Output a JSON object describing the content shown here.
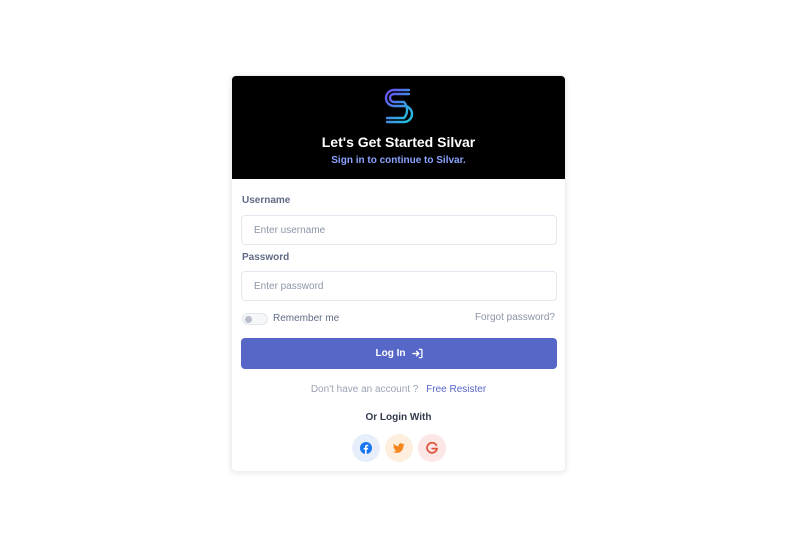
{
  "header": {
    "title": "Let's Get Started Silvar",
    "subtitle": "Sign in to continue to Silvar."
  },
  "form": {
    "username_label": "Username",
    "username_placeholder": "Enter username",
    "username_value": "",
    "password_label": "Password",
    "password_placeholder": "Enter password",
    "password_value": "",
    "remember_label": "Remember me",
    "remember_checked": false,
    "forgot_label": "Forgot password?",
    "login_label": "Log In"
  },
  "register": {
    "prompt": "Don't have an account ?",
    "link_label": "Free Resister"
  },
  "social": {
    "heading": "Or Login With",
    "buttons": [
      "facebook-icon",
      "twitter-icon",
      "google-icon"
    ]
  },
  "colors": {
    "header_bg": "#000000",
    "accent": "#5767c8",
    "facebook": "#1877f2",
    "twitter": "#f5861f",
    "google": "#e0533d"
  }
}
